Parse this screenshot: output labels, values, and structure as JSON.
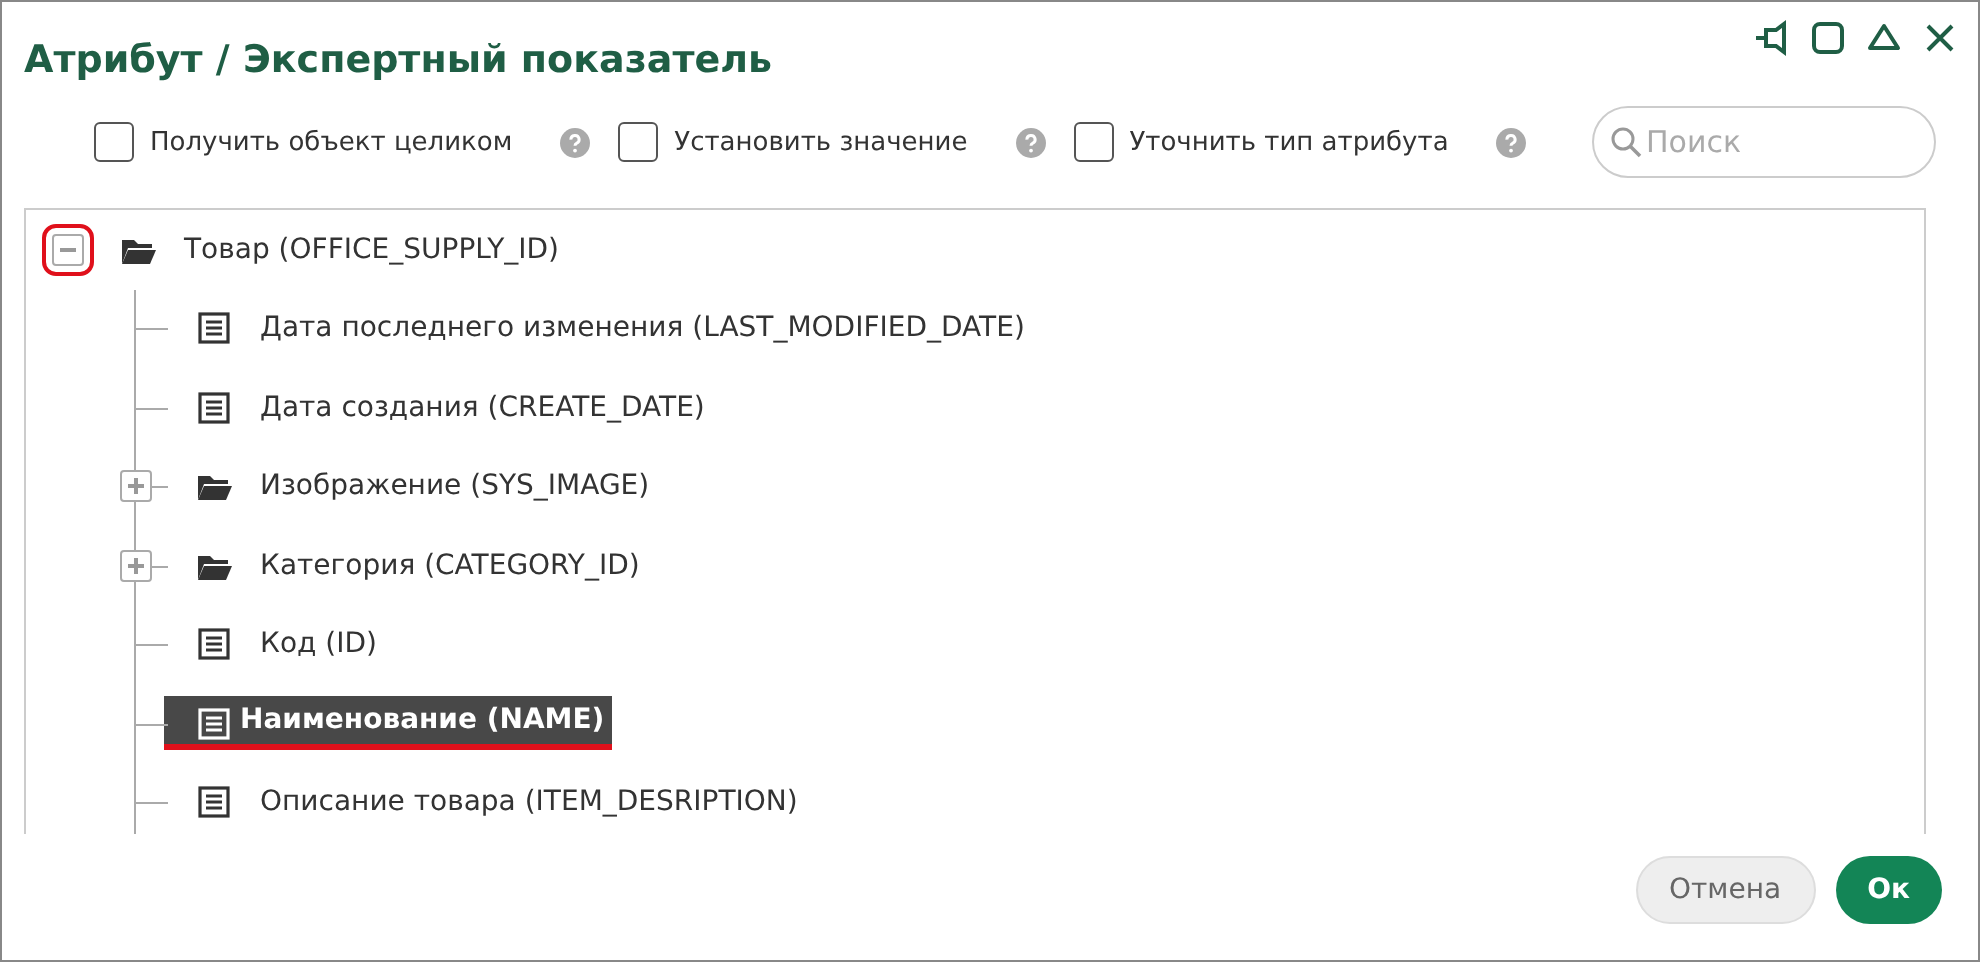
{
  "window": {
    "title": "Атрибут / Экспертный показатель"
  },
  "options": [
    {
      "label": "Получить объект целиком",
      "checked": false
    },
    {
      "label": "Установить значение",
      "checked": false
    },
    {
      "label": "Уточнить тип атрибута",
      "checked": false
    }
  ],
  "search": {
    "placeholder": "Поиск"
  },
  "tree": {
    "label": "Товар (OFFICE_SUPPLY_ID)",
    "kind": "folder",
    "expanded": true,
    "marked": true,
    "selected": false,
    "children": [
      {
        "label": "Дата последнего изменения (LAST_MODIFIED_DATE)",
        "kind": "field",
        "selected": false
      },
      {
        "label": "Дата создания (CREATE_DATE)",
        "kind": "field",
        "selected": false
      },
      {
        "label": "Изображение (SYS_IMAGE)",
        "kind": "folder",
        "expanded": false,
        "selected": false
      },
      {
        "label": "Категория (CATEGORY_ID)",
        "kind": "folder",
        "expanded": false,
        "selected": false
      },
      {
        "label": "Код (ID)",
        "kind": "field",
        "selected": false
      },
      {
        "label": "Наименование (NAME)",
        "kind": "field",
        "selected": true
      },
      {
        "label": "Описание товара (ITEM_DESRIPTION)",
        "kind": "field",
        "selected": false
      }
    ]
  },
  "buttons": [
    {
      "label": "Отмена",
      "kind": "secondary"
    },
    {
      "label": "Ок",
      "kind": "primary"
    }
  ]
}
